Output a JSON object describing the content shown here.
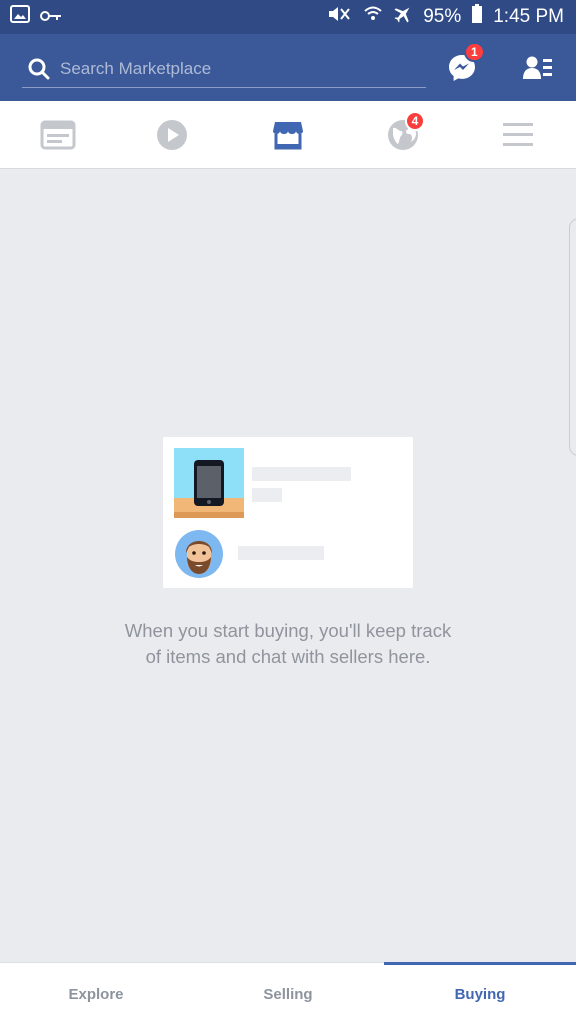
{
  "status_bar": {
    "battery": "95%",
    "time": "1:45 PM",
    "icons": [
      "image-icon",
      "key-icon",
      "mute-icon",
      "wifi-icon",
      "airplane-icon",
      "battery-icon"
    ]
  },
  "header": {
    "search_placeholder": "Search Marketplace",
    "messenger_badge": "1",
    "icons": [
      "search-icon",
      "messenger-icon",
      "profile-list-icon"
    ]
  },
  "nav": {
    "items": [
      {
        "name": "news-feed",
        "icon": "feed-icon"
      },
      {
        "name": "watch",
        "icon": "play-icon"
      },
      {
        "name": "marketplace",
        "icon": "shop-icon",
        "active": true
      },
      {
        "name": "notifications",
        "icon": "globe-icon",
        "badge": "4"
      },
      {
        "name": "menu",
        "icon": "hamburger-icon"
      }
    ]
  },
  "empty_state": {
    "message": "When you start buying, you'll keep track of items and chat with sellers here."
  },
  "tabs": [
    {
      "label": "Explore",
      "active": false
    },
    {
      "label": "Selling",
      "active": false
    },
    {
      "label": "Buying",
      "active": true
    }
  ],
  "colors": {
    "header_blue": "#3b5998",
    "status_blue": "#2f4a85",
    "background": "#e9ebee",
    "accent": "#4267b2",
    "badge_red": "#fa3e3e"
  }
}
